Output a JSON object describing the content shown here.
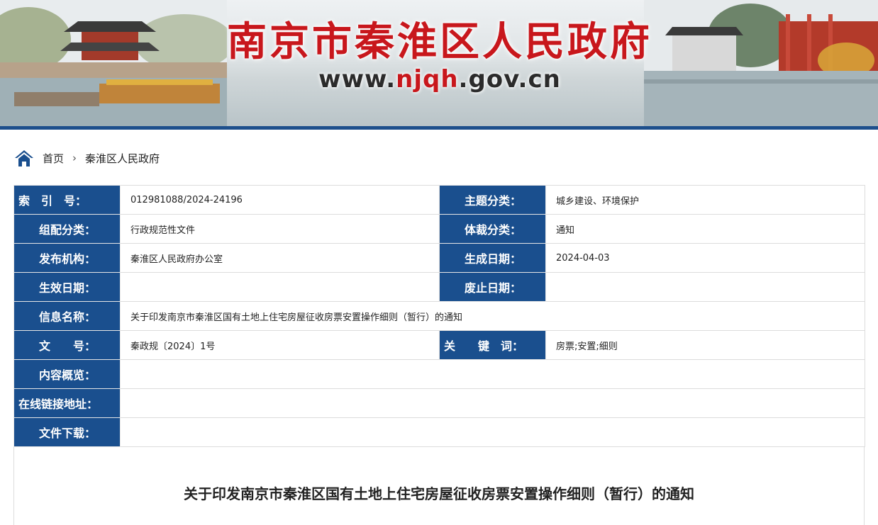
{
  "header": {
    "site_title": "南京市秦淮区人民政府",
    "site_url_prefix": "www.",
    "site_url_highlight": "njqh",
    "site_url_suffix": ".gov.cn"
  },
  "breadcrumb": {
    "icon": "home-icon",
    "home_label": "首页",
    "separator": "›",
    "current_label": "秦淮区人民政府"
  },
  "meta": {
    "index_label": "索　引　号：",
    "index_value": "012981088/2024-24196",
    "topic_label": "主题分类：",
    "topic_value": "城乡建设、环境保护",
    "category_label": "组配分类：",
    "category_value": "行政规范性文件",
    "genre_label": "体裁分类：",
    "genre_value": "通知",
    "publisher_label": "发布机构：",
    "publisher_value": "秦淮区人民政府办公室",
    "created_label": "生成日期：",
    "created_value": "2024-04-03",
    "effective_label": "生效日期：",
    "effective_value": "",
    "repeal_label": "废止日期：",
    "repeal_value": "",
    "info_name_label": "信息名称：",
    "info_name_value": "关于印发南京市秦淮区国有土地上住宅房屋征收房票安置操作细则（暂行）的通知",
    "doc_no_label": "文　　号：",
    "doc_no_value": "秦政规〔2024〕1号",
    "keywords_label": "关　　键　词：",
    "keywords_value": "房票;安置;细则",
    "summary_label": "内容概览：",
    "summary_value": "",
    "link_label": "在线链接地址：",
    "link_value": "",
    "download_label": "文件下载：",
    "download_value": ""
  },
  "document": {
    "title": "关于印发南京市秦淮区国有土地上住宅房屋征收房票安置操作细则（暂行）的通知"
  },
  "colors": {
    "label_bg": "#1a4f8e",
    "title_red": "#c8171c",
    "banner_bar": "#1d4f8c"
  }
}
